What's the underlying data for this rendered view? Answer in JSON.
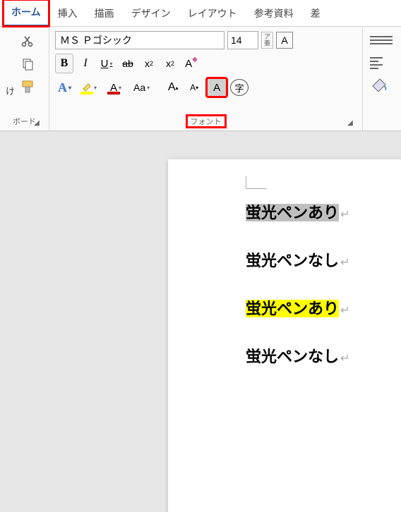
{
  "tabs": {
    "home": "ホーム",
    "insert": "挿入",
    "draw": "描画",
    "design": "デザイン",
    "layout": "レイアウト",
    "references": "参考資料",
    "mailings": "差"
  },
  "clipboard": {
    "paste_suffix": "け",
    "group_label": "ボード"
  },
  "font": {
    "name": "ＭＳ Ｐゴシック",
    "size": "14",
    "phonetic_top": "ア",
    "phonetic_bottom": "亜",
    "char_border": "A",
    "bold": "B",
    "italic": "I",
    "underline": "U",
    "strike": "ab",
    "subscript": "x",
    "subscript_sub": "2",
    "superscript": "x",
    "superscript_sup": "2",
    "clear_format": "A",
    "text_effect": "A",
    "highlight_btn": "",
    "font_color": "A",
    "change_case": "Aa",
    "grow": "A",
    "grow_sup": "▴",
    "shrink": "A",
    "shrink_sup": "▾",
    "shading": "A",
    "enclose": "字",
    "group_label": "フォント"
  },
  "document": {
    "line1": "蛍光ペンあり",
    "line2": "蛍光ペンなし",
    "line3": "蛍光ペンあり",
    "line4": "蛍光ペンなし",
    "return_mark": "↵"
  }
}
